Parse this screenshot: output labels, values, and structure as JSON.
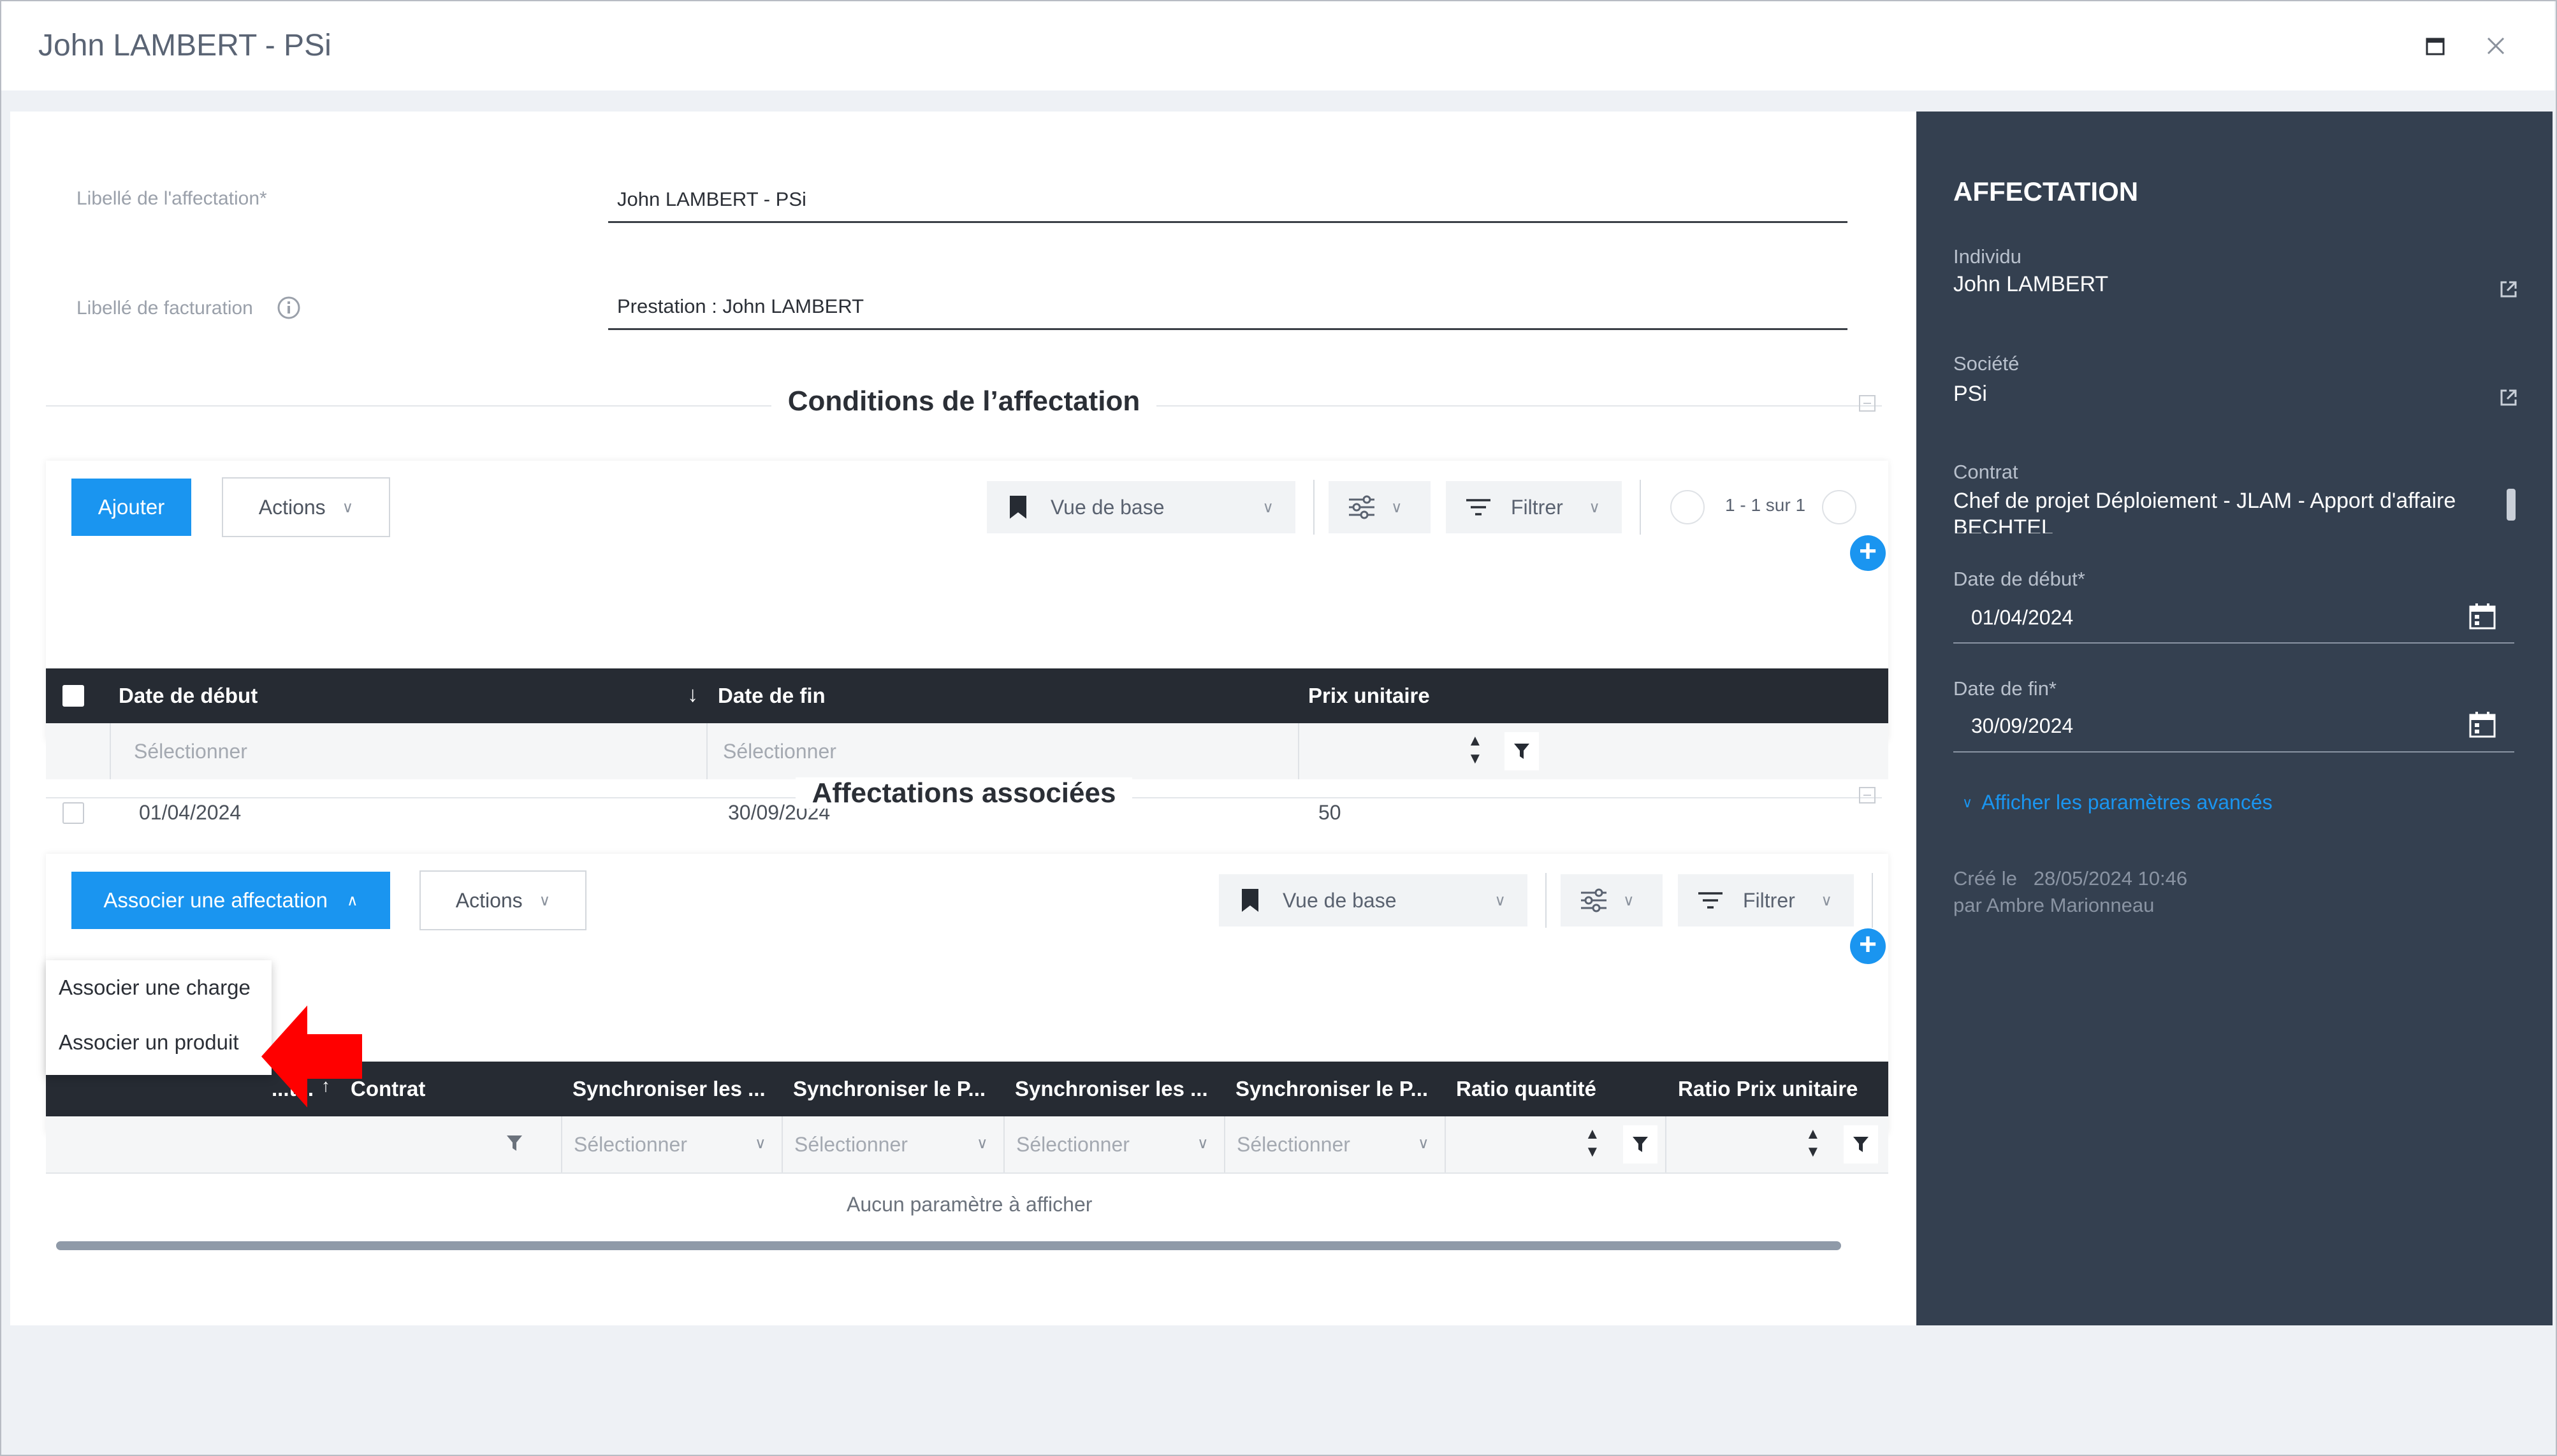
{
  "window": {
    "title": "John LAMBERT - PSi",
    "maximize_icon": "maximize-icon",
    "close_icon": "close-icon"
  },
  "form": {
    "libelle_label": "Libellé de l'affectation*",
    "libelle_value": "John LAMBERT - PSi",
    "facturation_label": "Libellé de facturation",
    "facturation_value": "Prestation : John LAMBERT"
  },
  "conditions": {
    "section_title": "Conditions de l’affectation",
    "add_button": "Ajouter",
    "actions_button": "Actions",
    "view_label": "Vue de base",
    "filter_label": "Filtrer",
    "pagination": "1 - 1 sur 1",
    "columns": [
      "Date de début",
      "Date de fin",
      "Prix unitaire"
    ],
    "filter_placeholders": [
      "Sélectionner",
      "Sélectionner"
    ],
    "rows": [
      {
        "date_debut": "01/04/2024",
        "date_fin": "30/09/2024",
        "prix": "50"
      }
    ]
  },
  "associees": {
    "section_title": "Affectations associées",
    "associate_button": "Associer une affectation",
    "actions_button": "Actions",
    "view_label": "Vue de base",
    "filter_label": "Filtrer",
    "columns": [
      "...t...",
      "Contrat",
      "Synchroniser les ...",
      "Synchroniser le P...",
      "Synchroniser les ...",
      "Synchroniser le P...",
      "Ratio quantité",
      "Ratio Prix unitaire"
    ],
    "filter_placeholders": [
      "Sélectionner",
      "Sélectionner",
      "Sélectionner",
      "Sélectionner"
    ],
    "empty_text": "Aucun paramètre à afficher",
    "dropdown_items": [
      "Associer une charge",
      "Associer un produit"
    ]
  },
  "sidebar": {
    "heading": "AFFECTATION",
    "individu_label": "Individu",
    "individu_value": "John LAMBERT",
    "societe_label": "Société",
    "societe_value": "PSi",
    "contrat_label": "Contrat",
    "contrat_value": "Chef de projet Déploiement - JLAM - Apport d'affaire",
    "contrat_value_cut": "BECHTEL",
    "date_debut_label": "Date de début*",
    "date_debut_value": "01/04/2024",
    "date_fin_label": "Date de fin*",
    "date_fin_value": "30/09/2024",
    "advanced_link": "Afficher les paramètres avancés",
    "created_label": "Créé le",
    "created_date": "28/05/2024 10:46",
    "created_by": "par Ambre Marionneau"
  },
  "colors": {
    "accent": "#1a95f0",
    "sidebar_bg": "#344050",
    "table_header": "#262b33",
    "annotation_arrow": "#ff0000"
  }
}
